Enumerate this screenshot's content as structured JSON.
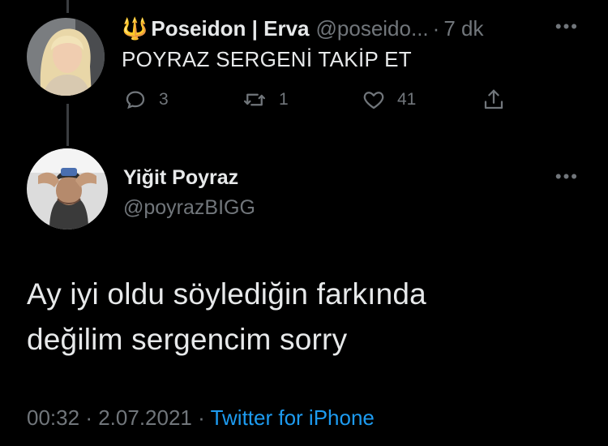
{
  "parent_tweet": {
    "name_emoji": "🔱",
    "display_name": "Poseidon | Erva",
    "handle": "@poseido...",
    "separator": "·",
    "time": "7 dk",
    "text": "POYRAZ SERGENİ TAKİP ET",
    "reply_count": "3",
    "retweet_count": "1",
    "like_count": "41"
  },
  "main_tweet": {
    "display_name": "Yiğit Poyraz",
    "handle": "@poyrazBIGG",
    "text_line1": "Ay iyi oldu söylediğin farkında",
    "text_line2": "değilim sergencim sorry",
    "time": "00:32",
    "sep1": "·",
    "date": "2.07.2021",
    "sep2": "·",
    "source": "Twitter for iPhone"
  },
  "more_icon": "more-horizontal-icon",
  "colors": {
    "background": "#000000",
    "text": "#e7e9ea",
    "muted": "#71767b",
    "link": "#1d9bf0",
    "trident": "#e8a317"
  }
}
